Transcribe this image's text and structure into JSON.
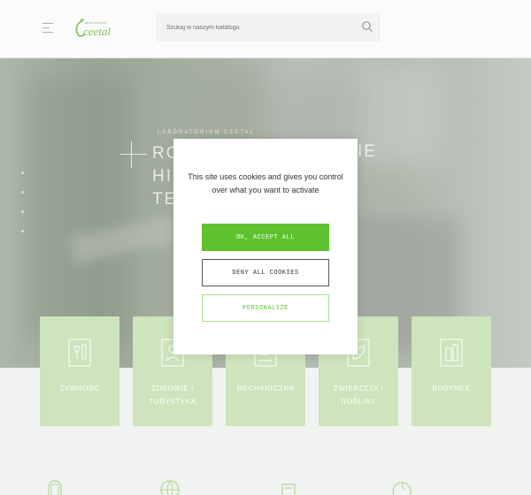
{
  "header": {
    "logo": {
      "name": "ceetal",
      "tagline": "laboratorium"
    },
    "search": {
      "placeholder": "Szukaj w naszym katalogu"
    }
  },
  "hero": {
    "label": "LABORATORIUM CEETAL",
    "title_line1": "RO",
    "title_line2": "HI",
    "title_line3": "TE",
    "title_right": "IE"
  },
  "categories": [
    {
      "label": "ŻYWNOŚĆ",
      "icon": "glass-bottle-icon"
    },
    {
      "label": "ZDROWIE I TURYSTYKA",
      "icon": "spa-icon"
    },
    {
      "label": "MECHANICZNA",
      "icon": "machine-icon"
    },
    {
      "label": "ZWIERZĘTA I ROŚLINY",
      "icon": "leaf-icon"
    },
    {
      "label": "BUDYNEK",
      "icon": "building-icon"
    }
  ],
  "cookie_banner": {
    "message": "This site uses cookies and gives you control over what you want to activate",
    "accept_label": "OK, ACCEPT ALL",
    "deny_label": "DENY ALL COOKIES",
    "personalize_label": "PERSONALIZE"
  },
  "colors": {
    "brand_green": "#5ec22e",
    "card_green": "#afd494",
    "logo_green": "#7fbf55"
  }
}
